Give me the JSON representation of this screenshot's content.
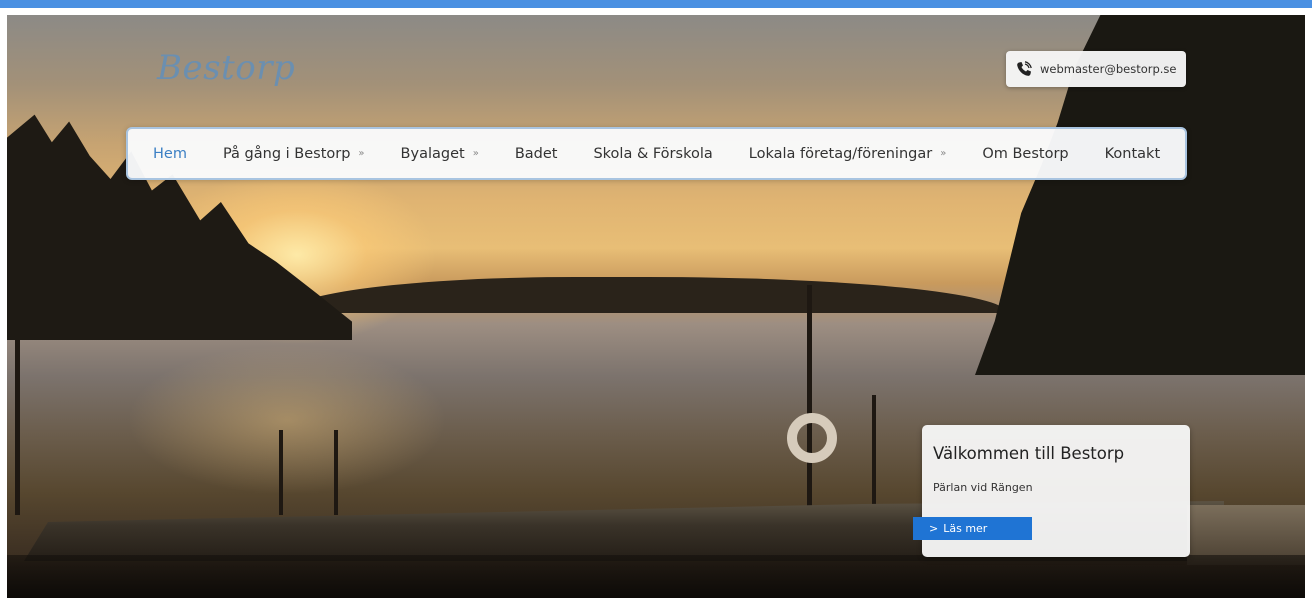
{
  "site": {
    "logo_text": "Bestorp"
  },
  "contact": {
    "icon": "phone-icon",
    "email": "webmaster@bestorp.se"
  },
  "nav": {
    "items": [
      {
        "label": "Hem",
        "active": true,
        "has_submenu": false
      },
      {
        "label": "På gång i Bestorp",
        "active": false,
        "has_submenu": true
      },
      {
        "label": "Byalaget",
        "active": false,
        "has_submenu": true
      },
      {
        "label": "Badet",
        "active": false,
        "has_submenu": false
      },
      {
        "label": "Skola & Förskola",
        "active": false,
        "has_submenu": false
      },
      {
        "label": "Lokala företag/föreningar",
        "active": false,
        "has_submenu": true
      },
      {
        "label": "Om Bestorp",
        "active": false,
        "has_submenu": false
      },
      {
        "label": "Kontakt",
        "active": false,
        "has_submenu": false
      }
    ],
    "submenu_glyph": "»"
  },
  "hero": {
    "welcome_title": "Välkommen till Bestorp",
    "welcome_subtitle": "Pärlan vid Rängen",
    "read_more_label": "Läs mer",
    "read_more_arrow": ">"
  },
  "colors": {
    "accent": "#1f74d4",
    "nav_active": "#3b7fc4",
    "logo": "#6b8fb0",
    "top_bar": "#4a90e2"
  }
}
